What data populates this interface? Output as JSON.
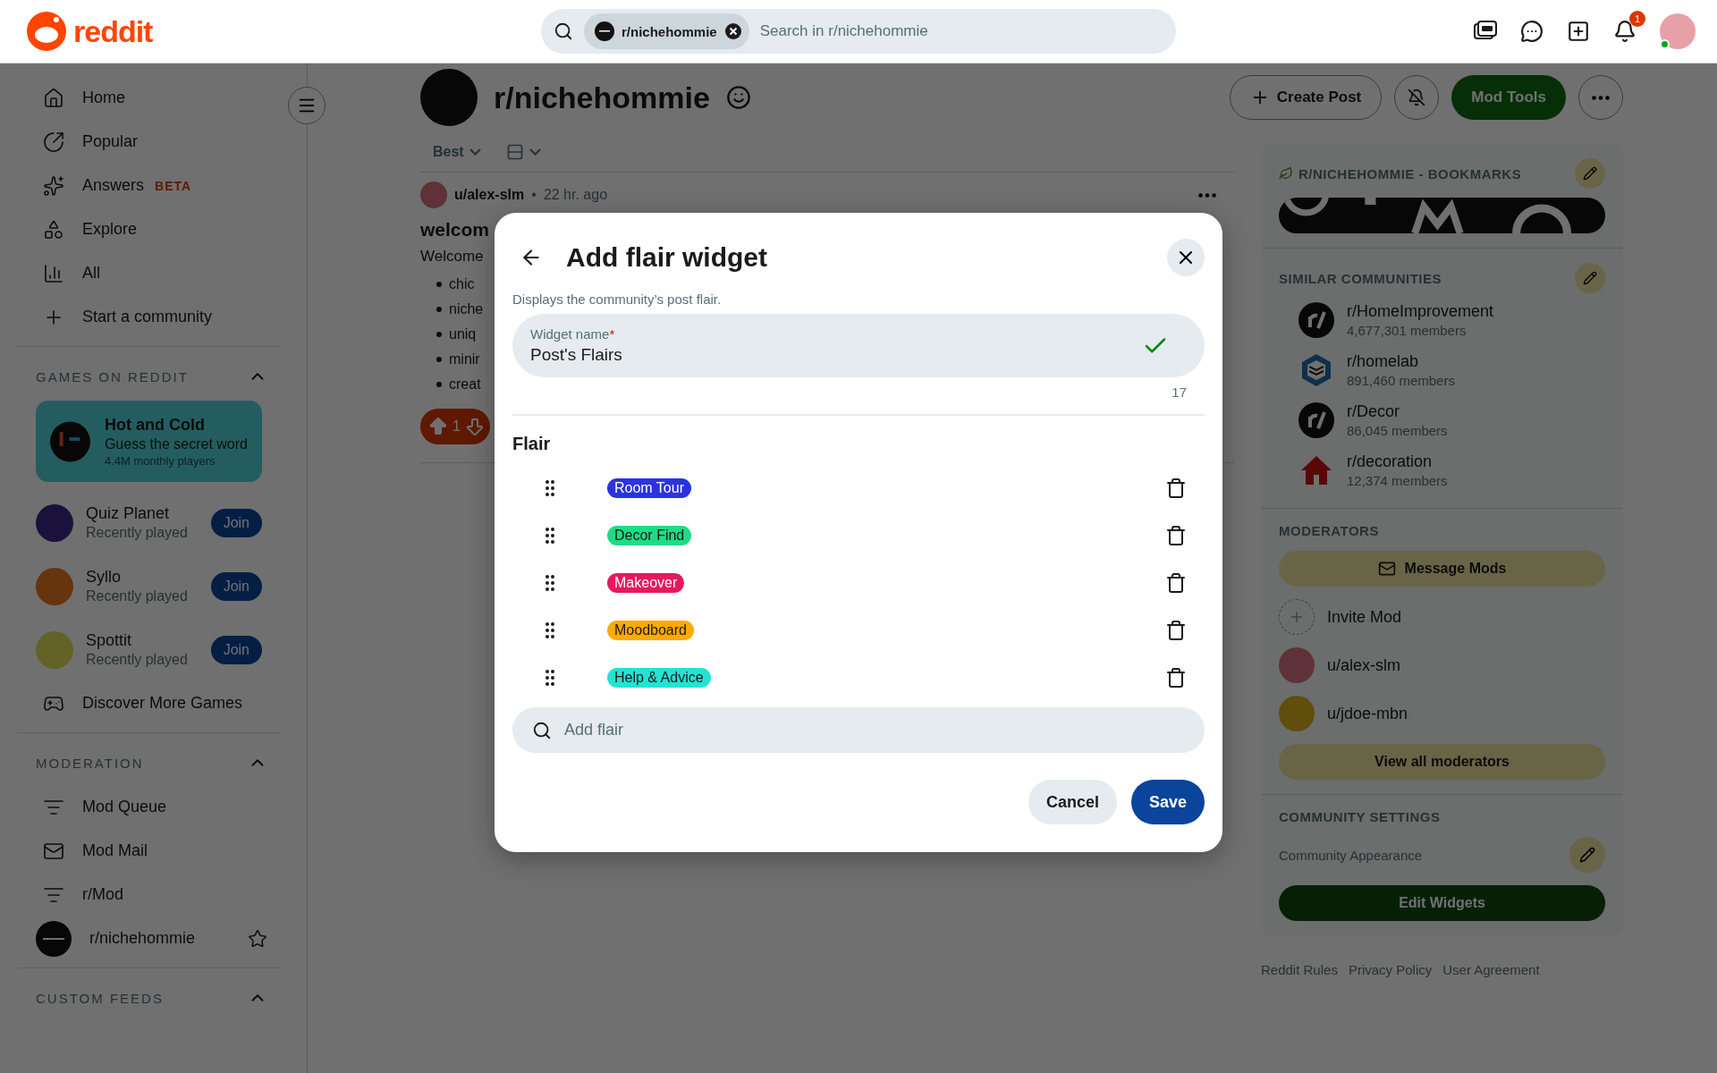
{
  "header": {
    "logo": "reddit",
    "search": {
      "chip": "r/nichehommie",
      "placeholder": "Search in r/nichehommie"
    },
    "notifications": "1",
    "online": true
  },
  "sidebar": {
    "nav": [
      {
        "label": "Home",
        "kind": "home"
      },
      {
        "label": "Popular",
        "kind": "popular"
      },
      {
        "label": "Answers",
        "kind": "answers",
        "badge": "BETA"
      },
      {
        "label": "Explore",
        "kind": "explore"
      },
      {
        "label": "All",
        "kind": "all"
      },
      {
        "label": "Start a community",
        "kind": "plus"
      }
    ],
    "games": {
      "title": "GAMES ON REDDIT",
      "expanded": true,
      "featured": {
        "name": "Hot and Cold",
        "tagline": "Guess the secret word",
        "players": "4.4M monthly players"
      },
      "items": [
        {
          "name": "Quiz Planet",
          "status": "Recently played",
          "action": "Join"
        },
        {
          "name": "Syllo",
          "status": "Recently played",
          "action": "Join"
        },
        {
          "name": "Spottit",
          "status": "Recently played",
          "action": "Join"
        }
      ],
      "more": "Discover More Games"
    },
    "moderation": {
      "title": "MODERATION",
      "expanded": true,
      "items": [
        {
          "label": "Mod Queue",
          "kind": "queue"
        },
        {
          "label": "Mod Mail",
          "kind": "mail"
        },
        {
          "label": "r/Mod",
          "kind": "queue"
        },
        {
          "label": "r/nichehommie",
          "kind": "community",
          "starred": false
        }
      ]
    },
    "custom_feeds": {
      "title": "CUSTOM FEEDS",
      "expanded": true
    }
  },
  "community": {
    "name": "r/nichehommie",
    "actions": [
      {
        "label": "Create Post",
        "kind": "outline"
      },
      {
        "kind": "notify"
      },
      {
        "label": "Mod Tools",
        "kind": "primary"
      },
      {
        "kind": "more"
      }
    ]
  },
  "feed": {
    "sort": "Best",
    "post": {
      "author": "u/alex-slm",
      "separator": "•",
      "time": "22 hr. ago",
      "title": "welcom",
      "body": "Welcome",
      "bullets": [
        "chic",
        "niche",
        "uniq",
        "minir",
        "creat"
      ],
      "votes": "1"
    }
  },
  "right": {
    "bookmarks": {
      "title": "R/NICHEHOMMIE - BOOKMARKS"
    },
    "similar": {
      "title": "SIMILAR COMMUNITIES",
      "items": [
        {
          "name": "r/HomeImprovement",
          "members": "4,677,301 members",
          "kind": "reddit"
        },
        {
          "name": "r/homelab",
          "members": "891,460 members",
          "kind": "cube"
        },
        {
          "name": "r/Decor",
          "members": "86,045 members",
          "kind": "reddit"
        },
        {
          "name": "r/decoration",
          "members": "12,374 members",
          "kind": "house"
        }
      ]
    },
    "moderators": {
      "title": "MODERATORS",
      "message": "Message Mods",
      "invite": "Invite Mod",
      "users": [
        {
          "name": "u/alex-slm"
        },
        {
          "name": "u/jdoe-mbn"
        }
      ],
      "view_all": "View all moderators"
    },
    "settings": {
      "title": "COMMUNITY SETTINGS",
      "appearance": "Community Appearance",
      "edit": "Edit Widgets"
    },
    "footer": [
      "Reddit Rules",
      "Privacy Policy",
      "User Agreement"
    ]
  },
  "modal": {
    "title": "Add flair widget",
    "description": "Displays the community’s post flair.",
    "field": {
      "label": "Widget name",
      "required_mark": "*",
      "value": "Post's Flairs",
      "valid": true,
      "counter": "17"
    },
    "section": "Flair",
    "flairs": [
      {
        "label": "Room Tour",
        "color": "#2b34dc"
      },
      {
        "label": "Decor Find",
        "color": "#1fdc84"
      },
      {
        "label": "Makeover",
        "color": "#e6195e"
      },
      {
        "label": "Moodboard",
        "color": "#ffaa00"
      },
      {
        "label": "Help & Advice",
        "color": "#25e2d2"
      }
    ],
    "add": {
      "placeholder": "Add flair"
    },
    "buttons": [
      {
        "label": "Cancel",
        "kind": "secondary"
      },
      {
        "label": "Save",
        "kind": "primary"
      }
    ]
  }
}
